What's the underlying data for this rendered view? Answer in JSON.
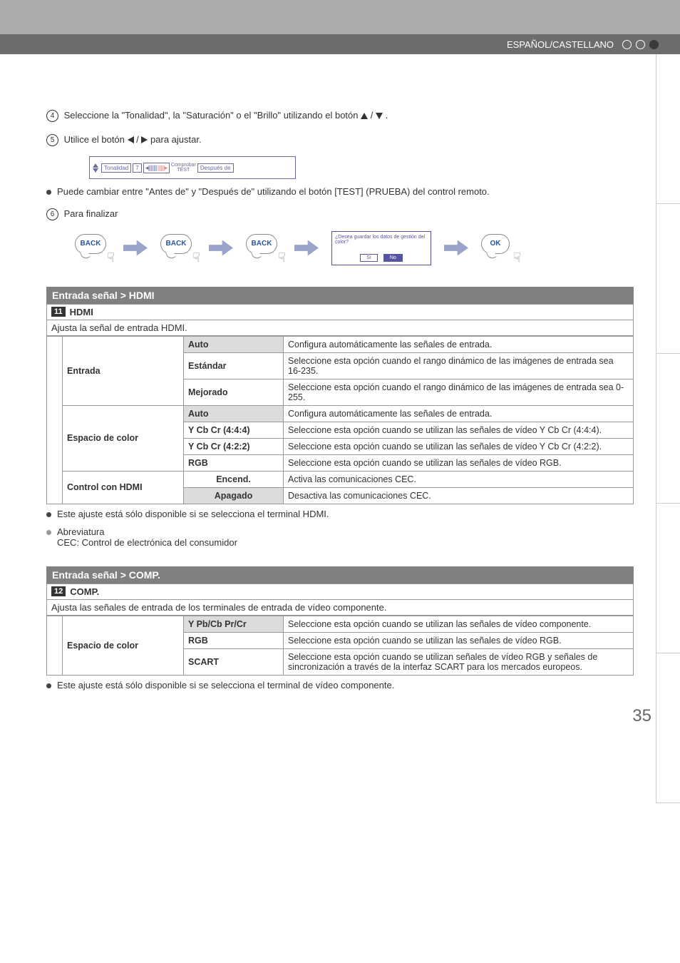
{
  "header": {
    "lang": "ESPAÑOL/CASTELLANO"
  },
  "steps": {
    "s4_num": "4",
    "s4_text_a": "Seleccione la \"Tonalidad\", la \"Saturación\" o el \"Brillo\" utilizando el botón",
    "s4_text_b": ".",
    "s5_num": "5",
    "s5_text_a": "Utilice el botón",
    "s5_text_b": "para ajustar.",
    "s6_num": "6",
    "s6_text": "Para finalizar"
  },
  "slider": {
    "label": "Tonalidad",
    "value": "7",
    "ticks_left": "◂|||||||",
    "ticks_right": "|||||▸",
    "check": "Comprobar",
    "test": "TEST",
    "after": "Después de"
  },
  "bullet1": "Puede cambiar entre \"Antes de\" y \"Después de\" utilizando el botón [TEST] (PRUEBA) del control remoto.",
  "back_label": "BACK",
  "ok_label": "OK",
  "dialog": {
    "question": "¿Desea guardar los datos de gestión del color?",
    "yes": "Sí",
    "no": "No"
  },
  "section_hdmi": {
    "title": "Entrada señal > HDMI",
    "num": "11",
    "sub": "HDMI",
    "desc": "Ajusta la señal de entrada HDMI.",
    "rows": {
      "entrada": "Entrada",
      "auto": "Auto",
      "auto_desc": "Configura automáticamente las señales de entrada.",
      "estandar": "Estándar",
      "estandar_desc": "Seleccione esta opción cuando el rango dinámico de las imágenes de entrada sea 16-235.",
      "mejorado": "Mejorado",
      "mejorado_desc": "Seleccione esta opción cuando el rango dinámico de las imágenes de entrada sea 0-255.",
      "espacio": "Espacio de color",
      "auto2_desc": "Configura automáticamente las señales de entrada.",
      "ycbcr444": "Y Cb Cr (4:4:4)",
      "ycbcr444_desc": "Seleccione esta opción cuando se utilizan las señales de vídeo Y Cb Cr (4:4:4).",
      "ycbcr422": "Y Cb Cr (4:2:2)",
      "ycbcr422_desc": "Seleccione esta opción cuando se utilizan las señales de vídeo Y Cb Cr (4:2:2).",
      "rgb": "RGB",
      "rgb_desc": "Seleccione esta opción cuando se utilizan las señales de vídeo RGB.",
      "control": "Control con HDMI",
      "encend": "Encend.",
      "encend_desc": "Activa las comunicaciones CEC.",
      "apagado": "Apagado",
      "apagado_desc": "Desactiva las comunicaciones CEC."
    },
    "note1": "Este ajuste está sólo disponible si se selecciona el terminal HDMI.",
    "note2a": "Abreviatura",
    "note2b": "CEC: Control de electrónica del consumidor"
  },
  "section_comp": {
    "title": "Entrada señal > COMP.",
    "num": "12",
    "sub": "COMP.",
    "desc": "Ajusta las señales de entrada de los terminales de entrada de vídeo componente.",
    "rows": {
      "espacio": "Espacio de color",
      "ypbcb": "Y Pb/Cb Pr/Cr",
      "ypbcb_desc": "Seleccione esta opción cuando se utilizan las señales de vídeo componente.",
      "rgb": "RGB",
      "rgb_desc": "Seleccione esta opción cuando se utilizan las señales de vídeo RGB.",
      "scart": "SCART",
      "scart_desc": "Seleccione esta opción cuando se utilizan señales de vídeo RGB y señales de sincronización a través de la interfaz SCART para los mercados europeos."
    },
    "note": "Este ajuste está sólo disponible si se selecciona el terminal de vídeo componente."
  },
  "divider": "/",
  "page_number": "35"
}
